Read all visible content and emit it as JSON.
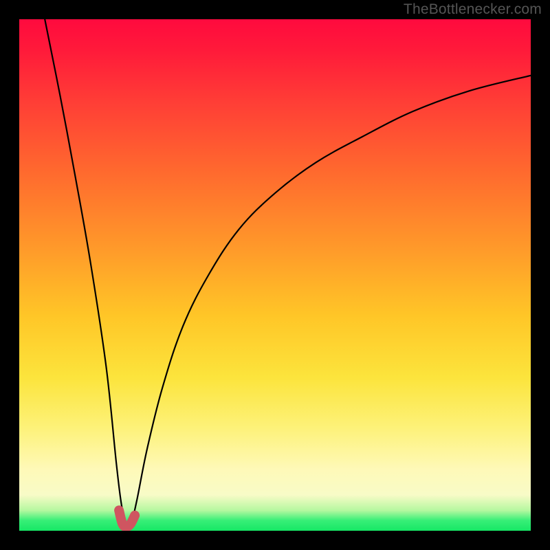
{
  "watermark": {
    "text": "TheBottlenecker.com"
  },
  "accent_color": "#cf5560",
  "chart_data": {
    "type": "line",
    "title": "",
    "xlabel": "",
    "ylabel": "",
    "xlim": [
      0,
      100
    ],
    "ylim": [
      0,
      100
    ],
    "note": "Axes are unlabeled; values below are normalized 0–100 estimates read from pixel positions. y represents distance from the bottom green band (0 = bottom, 100 = top). The curve plunges to ~0 near x≈21 then rises asymptotically toward ~89 at the right edge.",
    "series": [
      {
        "name": "bottleneck-curve",
        "x": [
          5,
          8,
          11,
          14,
          17,
          19,
          20,
          21,
          22,
          23,
          25,
          28,
          32,
          37,
          43,
          50,
          58,
          67,
          77,
          88,
          100
        ],
        "y": [
          100,
          85,
          69,
          52,
          32,
          13,
          5,
          1,
          2,
          6,
          16,
          28,
          40,
          50,
          59,
          66,
          72,
          77,
          82,
          86,
          89
        ]
      }
    ],
    "accent_segment": {
      "name": "highlighted-minimum",
      "x": [
        19.5,
        20.2,
        21.0,
        21.8,
        22.6
      ],
      "y": [
        4.0,
        1.3,
        0.8,
        1.4,
        3.0
      ]
    }
  }
}
